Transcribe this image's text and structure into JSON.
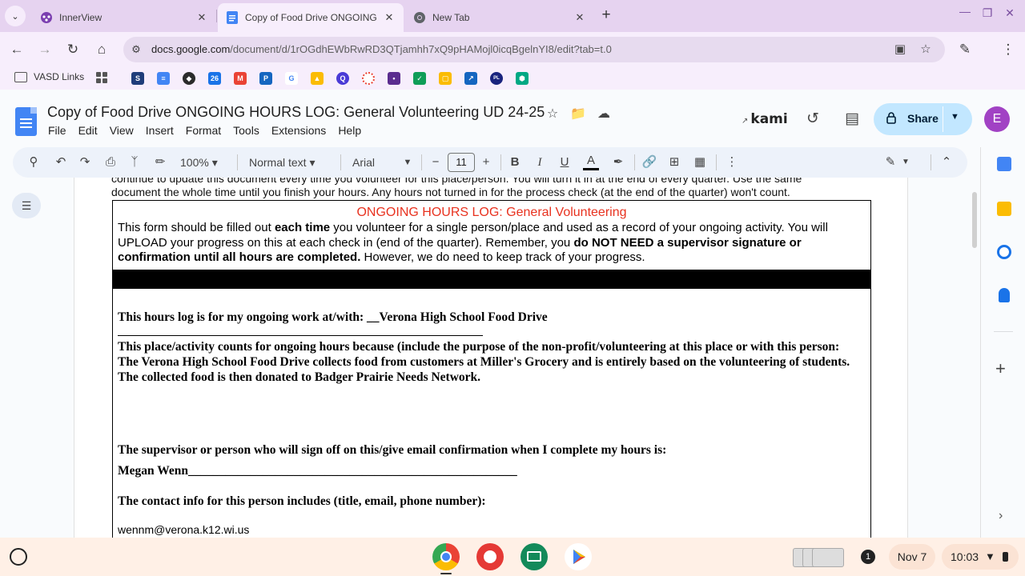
{
  "browser": {
    "tabs": [
      {
        "title": "InnerView",
        "close": "✕"
      },
      {
        "title": "Copy of Food Drive ONGOING H",
        "close": "✕"
      },
      {
        "title": "New Tab",
        "close": "✕"
      }
    ],
    "new_tab": "+",
    "url_host": "docs.google.com",
    "url_path": "/document/d/1rOGdhEWbRwRD3QTjamhh7xQ9pHAMojl0icqBgelnYI8/edit?tab=t.0",
    "bookmarks_folder": "VASD Links"
  },
  "docs": {
    "title": "Copy of Food Drive ONGOING HOURS LOG: General Volunteering UD 24-25",
    "menu": [
      "File",
      "Edit",
      "View",
      "Insert",
      "Format",
      "Tools",
      "Extensions",
      "Help"
    ],
    "kami": "kami",
    "share_label": "Share",
    "avatar_initial": "E",
    "colors": {
      "share_bg": "#c2e7ff",
      "avatar_bg": "#a142c4",
      "form_title": "#e8321f"
    }
  },
  "toolbar": {
    "zoom": "100%",
    "style": "Normal text",
    "font": "Arial",
    "font_size": "11",
    "bold": "B",
    "italic": "I",
    "underline": "U",
    "text_color": "A"
  },
  "document": {
    "intro_line1": "continue to update this document every time you volunteer for this place/person. You will turn it in at the end of every quarter. Use the same",
    "intro_line2": "document the whole time until you finish your hours. Any hours not turned in for the process check (at the end of the quarter) won't count.",
    "form_title": "ONGOING HOURS LOG: General Volunteering",
    "desc_part1": "This form should be filled out ",
    "desc_bold1": "each time",
    "desc_part2": " you volunteer for a single person/place and used as a record of your ongoing activity. You will UPLOAD your progress on this at each check in (end of the quarter). Remember, you ",
    "desc_bold2": "do NOT NEED a supervisor signature or confirmation until all hours are completed.",
    "desc_part3": " However, we do need to keep track of your progress.",
    "ongoing_work": "This hours log is for my ongoing work at/with: __Verona High School Food Drive",
    "counts_because": "This place/activity counts for ongoing hours because (include the purpose of the non-profit/volunteering at this place or with this person: The Verona High School Food Drive collects food from customers at Miller's Grocery and is entirely based on the volunteering of students. The collected food is then donated to Badger Prairie Needs Network.",
    "supervisor_prompt": "The supervisor or person who will sign off on this/give email confirmation when I complete my hours is:",
    "supervisor_name": "Megan Wenn_____________________________________________________",
    "contact_prompt": "The contact info for this person includes (title, email, phone number):",
    "contact_email": "wennm@verona.k12.wi.us"
  },
  "shelf": {
    "notification_count": "1",
    "date": "Nov 7",
    "time": "10:03"
  },
  "icons": [
    "tab-search-icon",
    "innerview-favicon",
    "docs-favicon",
    "chrome-favicon",
    "back-icon",
    "forward-icon",
    "reload-icon",
    "home-icon",
    "site-settings-icon",
    "install-app-icon",
    "bookmark-star-icon",
    "extensions-icon",
    "more-vert-icon",
    "star-icon",
    "move-folder-icon",
    "cloud-status-icon",
    "history-icon",
    "comments-icon",
    "lock-icon",
    "search-menus-icon",
    "undo-icon",
    "redo-icon",
    "print-icon",
    "spellcheck-icon",
    "paint-format-icon",
    "highlight-icon",
    "link-icon",
    "add-comment-icon",
    "image-icon",
    "pencil-icon",
    "collapse-icon",
    "outline-icon",
    "calendar-icon",
    "keep-icon",
    "tasks-icon",
    "contacts-icon",
    "add-icon",
    "launcher-icon",
    "wifi-icon",
    "battery-icon"
  ]
}
